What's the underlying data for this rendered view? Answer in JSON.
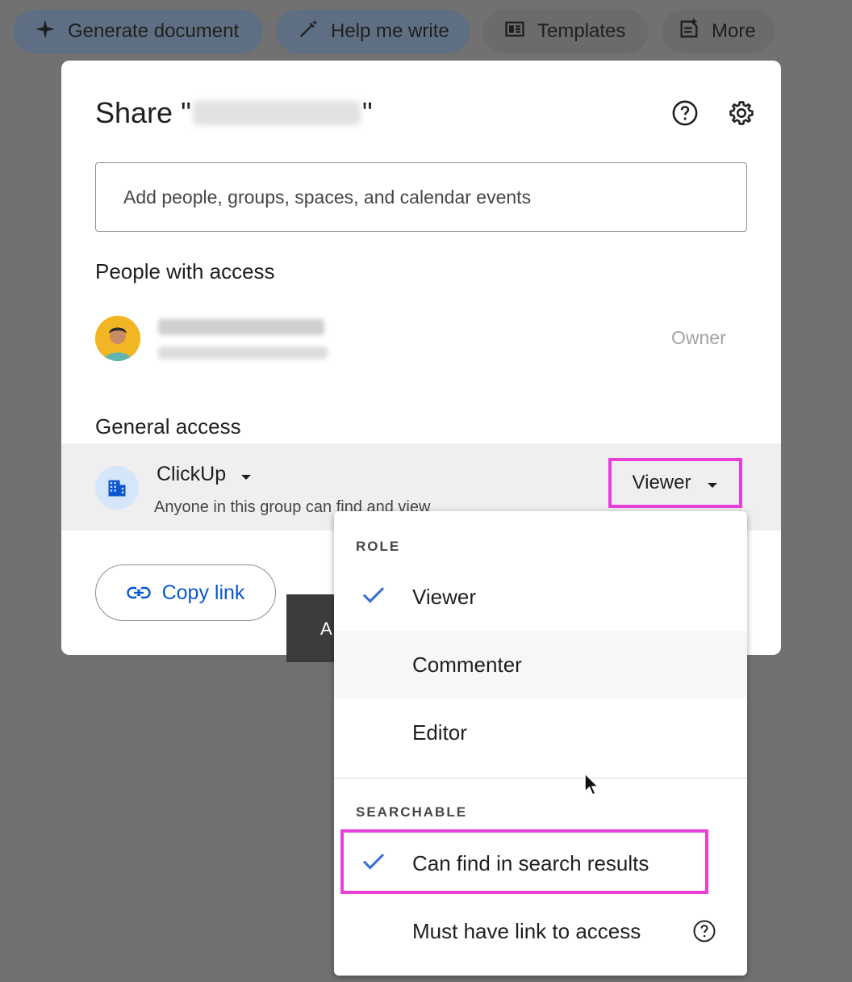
{
  "toolbar": {
    "chips": [
      {
        "label": "Generate document",
        "icon": "sparkle-icon"
      },
      {
        "label": "Help me write",
        "icon": "pen-sparkle-icon"
      },
      {
        "label": "Templates",
        "icon": "template-icon"
      },
      {
        "label": "More",
        "icon": "note-add-icon"
      }
    ]
  },
  "dialog": {
    "title_prefix": "Share \"",
    "title_suffix": "\"",
    "add_placeholder": "Add people, groups, spaces, and calendar events",
    "people_heading": "People with access",
    "owner_role": "Owner",
    "general_heading": "General access",
    "group_name": "ClickUp",
    "group_desc": "Anyone in this group can find and view",
    "role_button": "Viewer",
    "copy_link": "Copy link",
    "partial_button": "A"
  },
  "menu": {
    "role_heading": "ROLE",
    "roles": [
      {
        "label": "Viewer",
        "checked": true
      },
      {
        "label": "Commenter",
        "checked": false
      },
      {
        "label": "Editor",
        "checked": false
      }
    ],
    "searchable_heading": "SEARCHABLE",
    "search_options": [
      {
        "label": "Can find in search results",
        "checked": true
      },
      {
        "label": "Must have link to access",
        "checked": false
      }
    ]
  },
  "colors": {
    "highlight": "#e83fdb",
    "link_blue": "#0b57d0",
    "check_blue": "#3b6fd6"
  }
}
